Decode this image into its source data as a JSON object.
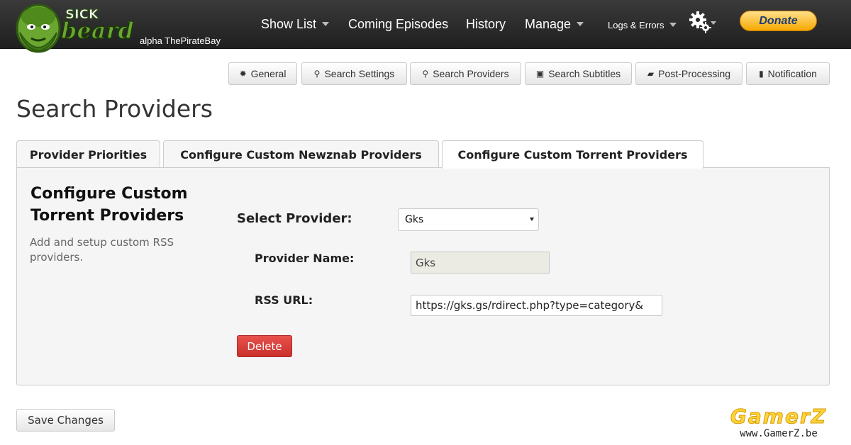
{
  "brand": {
    "subtitle": "alpha ThePirateBay",
    "colors": {
      "primary_green": "#6aa630",
      "dark_green": "#2f5a12"
    }
  },
  "nav": {
    "items": [
      {
        "label": "Show List",
        "has_dropdown": true
      },
      {
        "label": "Coming Episodes",
        "has_dropdown": false
      },
      {
        "label": "History",
        "has_dropdown": false
      },
      {
        "label": "Manage",
        "has_dropdown": true
      },
      {
        "label": "Logs & Errors",
        "has_dropdown": true
      }
    ],
    "settings_icon": "gear-icon",
    "donate_label": "Donate"
  },
  "subnav": {
    "items": [
      {
        "label": "General",
        "icon": "gear-icon"
      },
      {
        "label": "Search Settings",
        "icon": "search-icon"
      },
      {
        "label": "Search Providers",
        "icon": "search-icon"
      },
      {
        "label": "Search Subtitles",
        "icon": "comment-icon"
      },
      {
        "label": "Post-Processing",
        "icon": "folder-open-icon"
      },
      {
        "label": "Notification",
        "icon": "book-icon"
      }
    ]
  },
  "page": {
    "title": "Search Providers"
  },
  "tabs": [
    {
      "label": "Provider Priorities",
      "active": false
    },
    {
      "label": "Configure Custom Newznab Providers",
      "active": false
    },
    {
      "label": "Configure Custom Torrent Providers",
      "active": true
    }
  ],
  "section": {
    "title": "Configure Custom Torrent Providers",
    "description": "Add and setup custom RSS providers."
  },
  "form": {
    "select_provider_label": "Select Provider:",
    "selected_provider": "Gks",
    "provider_name_label": "Provider Name:",
    "provider_name_value": "Gks",
    "rss_url_label": "RSS URL:",
    "rss_url_value": "https://gks.gs/rdirect.php?type=category&",
    "delete_label": "Delete",
    "delete_color": "#d9534f"
  },
  "footer": {
    "save_label": "Save Changes"
  },
  "watermark": {
    "logo_text": "GamerZ",
    "url": "www.GamerZ.be"
  }
}
